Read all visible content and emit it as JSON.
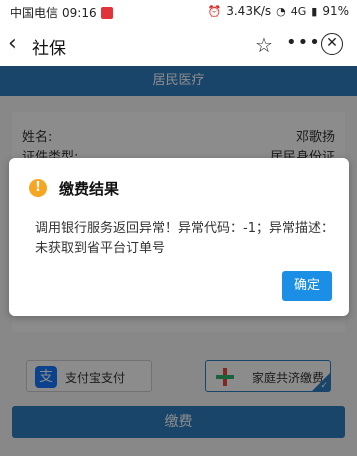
{
  "status_bar": {
    "carrier": "中国电信",
    "time": "09:16",
    "speed": "3.43K/s",
    "signal": "4G",
    "battery": "91%"
  },
  "title_bar": {
    "title": "社保",
    "back_icon": "chevron-left-icon",
    "star_icon": "star-icon",
    "more_icon": "more-icon",
    "close_icon": "close-circle-icon"
  },
  "page": {
    "section_header": "居民医疗",
    "info": [
      {
        "key": "姓名:",
        "value": "邓歌扬"
      },
      {
        "key": "证件类型:",
        "value": "居民身份证"
      }
    ],
    "payment_options": [
      {
        "label": "支付宝支付",
        "icon": "alipay-icon",
        "selected": false
      },
      {
        "label": "家庭共济缴费",
        "icon": "family-pay-icon",
        "selected": true
      }
    ],
    "pay_button": "缴费"
  },
  "dialog": {
    "title": "缴费结果",
    "message": "调用银行服务返回异常！异常代码：-1；异常描述：未获取到省平台订单号",
    "ok_button": "确定",
    "icon": "warning-icon"
  },
  "colors": {
    "accent": "#2f7fc1",
    "ok_button": "#1b8ee6",
    "warning": "#f5a623"
  }
}
